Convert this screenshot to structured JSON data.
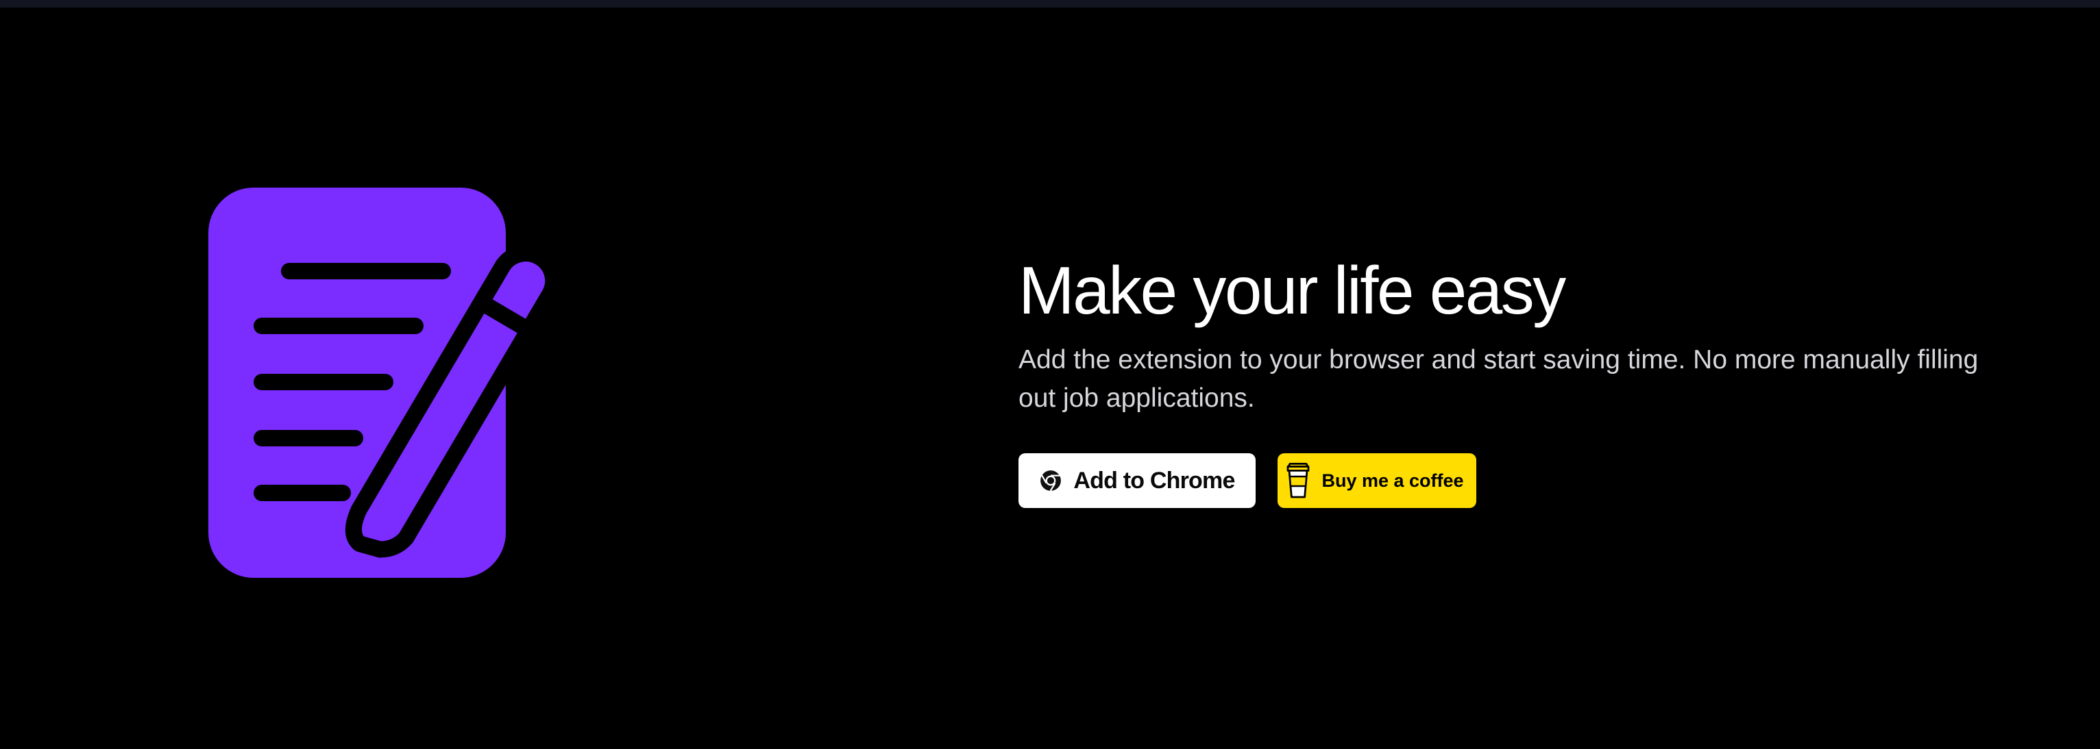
{
  "hero": {
    "title": "Make your life easy",
    "subtitle": "Add the extension to your browser and start saving time. No more manually filling out job applications."
  },
  "buttons": {
    "chrome": {
      "label": "Add to Chrome",
      "icon": "chrome-icon"
    },
    "coffee": {
      "label": "Buy me a coffee",
      "icon": "coffee-cup-icon"
    }
  },
  "illustration": {
    "icon": "document-pencil-icon"
  },
  "colors": {
    "background": "#000000",
    "accent_purple": "#7b2cff",
    "coffee_yellow": "#ffdd00",
    "chrome_button": "#ffffff"
  }
}
